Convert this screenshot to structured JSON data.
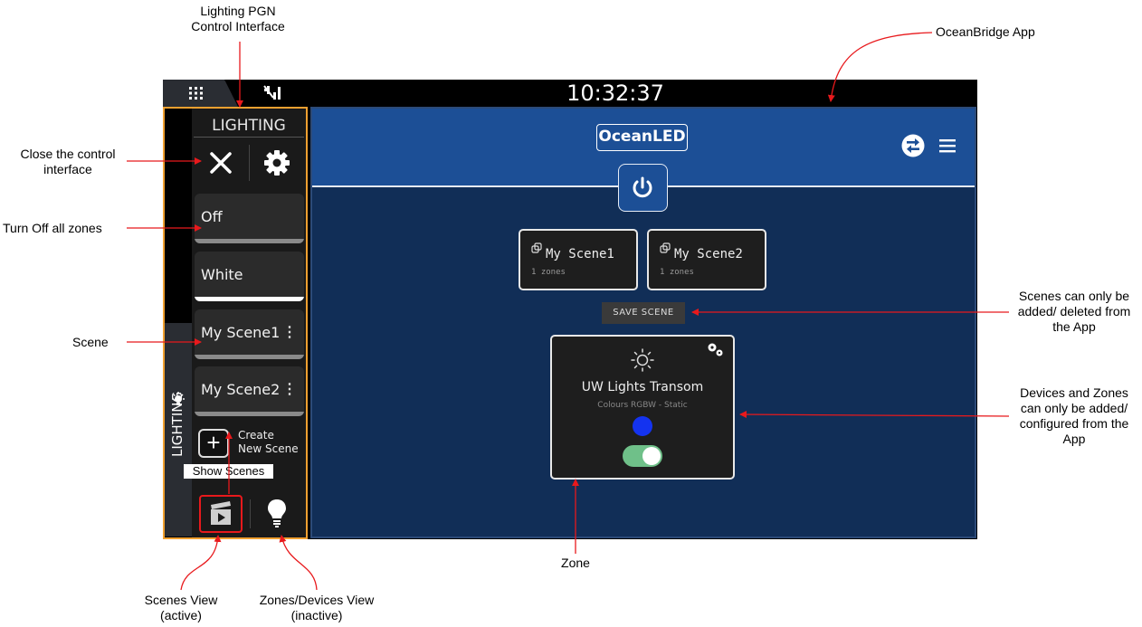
{
  "status_bar": {
    "time": "10:32:37",
    "grid_icon": "grid-icon",
    "signal_icon": "no-gps-signal-icon"
  },
  "lighting_panel": {
    "title": "LIGHTING",
    "side_tab_label": "LIGHTING",
    "scenes": [
      {
        "label": "Off",
        "bar_color": "#8a8a8a",
        "has_menu": false
      },
      {
        "label": "White",
        "bar_color": "#ffffff",
        "has_menu": false
      },
      {
        "label": "My Scene1",
        "bar_color": "#8a8a8a",
        "has_menu": true
      },
      {
        "label": "My Scene2",
        "bar_color": "#8a8a8a",
        "has_menu": true
      }
    ],
    "menu_glyph": "⋮",
    "create_plus": "+",
    "create_line1": "Create",
    "create_line2": "New Scene",
    "show_scenes_label": "Show  Scenes",
    "accent_color": "#f0a030"
  },
  "app": {
    "logo": "OceanLED",
    "scenes": [
      {
        "name": "My Scene1",
        "count": "1 zones"
      },
      {
        "name": "My Scene2",
        "count": "1 zones"
      }
    ],
    "save_scene_label": "SAVE SCENE",
    "zone": {
      "name": "UW Lights Transom",
      "subtitle": "Colours RGBW - Static",
      "color": "#1433f0",
      "toggle_on": true
    }
  },
  "annotations": {
    "lighting_pgn": [
      "Lighting PGN",
      "Control Interface"
    ],
    "oceanbridge": "OceanBridge App",
    "close": [
      "Close the control",
      "interface"
    ],
    "turn_off": "Turn Off all zones",
    "scene": "Scene",
    "scenes_only": [
      "Scenes can only be",
      "added/ deleted from",
      "the App"
    ],
    "devices_zones": [
      "Devices and Zones",
      "can only be added/",
      "configured from the",
      "App"
    ],
    "zone": "Zone",
    "scenes_view": [
      "Scenes View",
      "(active)"
    ],
    "zones_view": [
      "Zones/Devices View",
      "(inactive)"
    ],
    "arrow_color": "#e8191c"
  }
}
